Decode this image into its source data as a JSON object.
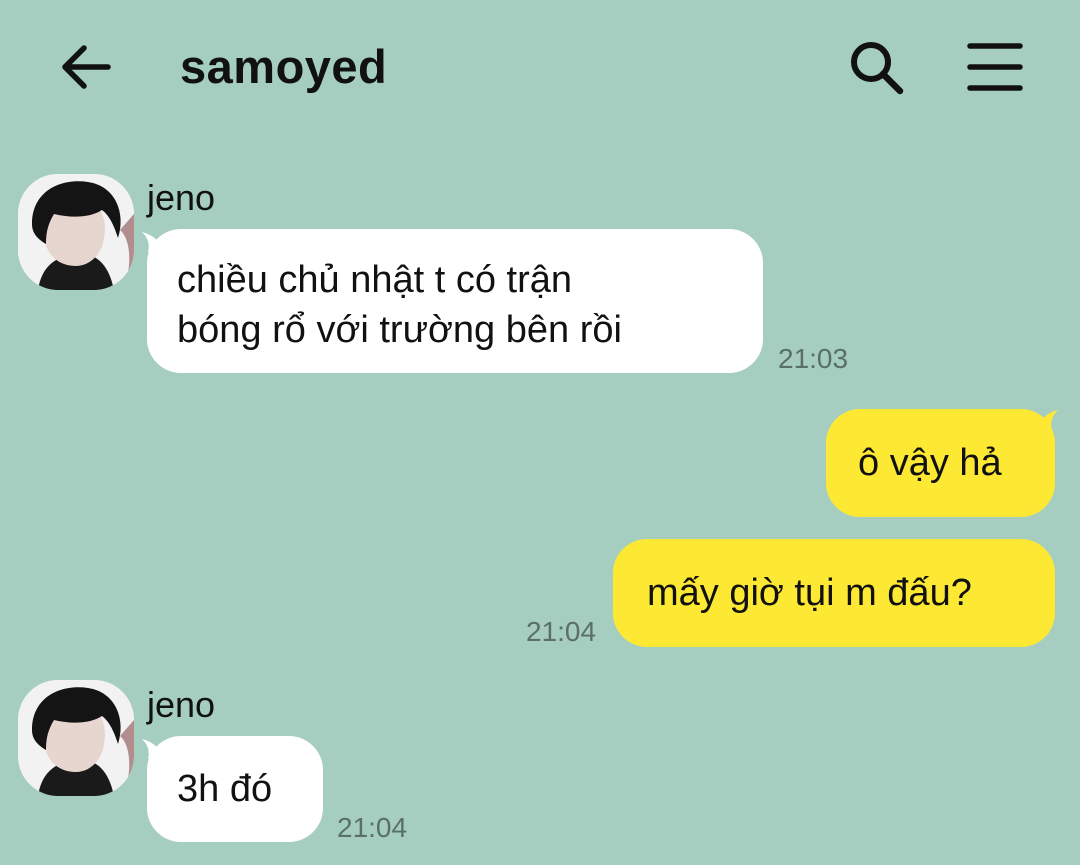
{
  "header": {
    "title": "samoyed",
    "back_icon": "arrow-left-icon",
    "search_icon": "search-icon",
    "menu_icon": "hamburger-menu-icon"
  },
  "colors": {
    "background": "#a5cec1",
    "incoming_bubble": "#ffffff",
    "outgoing_bubble": "#fde933",
    "timestamp": "#5b6f69"
  },
  "messages": [
    {
      "direction": "incoming",
      "sender": "jeno",
      "lines": [
        "chiều chủ nhật t có trận",
        "bóng rổ với trường bên rồi"
      ],
      "time": "21:03"
    },
    {
      "direction": "outgoing",
      "lines": [
        "ô vậy hả"
      ],
      "time": ""
    },
    {
      "direction": "outgoing",
      "lines": [
        "mấy giờ tụi m đấu?"
      ],
      "time": "21:04"
    },
    {
      "direction": "incoming",
      "sender": "jeno",
      "lines": [
        "3h đó"
      ],
      "time": "21:04"
    }
  ]
}
